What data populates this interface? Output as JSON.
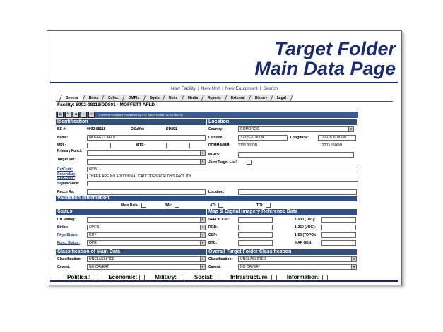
{
  "slide": {
    "title_line1": "Target Folder",
    "title_line2": "Main Data Page"
  },
  "nav": {
    "items": [
      "New Facility",
      "New Unit",
      "New Equipment",
      "Search"
    ],
    "separator": "|"
  },
  "tabs": [
    "General",
    "Bmks",
    "Collec",
    "DMPIs",
    "Equip",
    "Units",
    "Media",
    "Reports",
    "External",
    "History",
    "Legal"
  ],
  "facility": "Facility: 8992-08118/DD801 - MOFFETT AFLD",
  "toolbar": {
    "message": "Folder is Published (Published by FTC Saum MoffAF on 04 Nov 02 )"
  },
  "identification": {
    "header": "Identification",
    "be_label": "BE #:",
    "be_value": "0992-08118",
    "osuffix_label": "OSuffix:",
    "osuffix_value": "DD801",
    "name_label": "Name:",
    "name_value": "MOFFETT AFLD",
    "mrl_label": "MRL:",
    "mtf_label": "MTF:",
    "primary_label": "Primary Funct:",
    "target_set_label": "Target Set:",
    "catcode_label": "CatCode:",
    "catcode_value": "80051 -",
    "secondary_label": "Secondary CatCodes:",
    "secondary_value": "THERE ARE NO ADDITIONAL CATCODES FOR THIS FACILITY",
    "significance_label": "Significance:",
    "recce_label": "Recce Rx:"
  },
  "location": {
    "header": "Location",
    "country_label": "Country:",
    "country_value": "COMOROS",
    "latitude_label": "Latitude:",
    "latitude_value": "37-05-20.800N",
    "longitude_label": "Longitude:",
    "longitude_value": "122-03-39.000W",
    "ddmm_label": "DDMM.MMM:",
    "ddmm_lat": "3705.3333N",
    "ddmm_lon": "12203.6500W",
    "mgrs_label": "MGRS:",
    "joint_label": "Joint Target List?",
    "location_label": "Location:"
  },
  "validation": {
    "header": "Validation Information",
    "main_data_label": "Main Data:",
    "bai_label": "BAI:",
    "ati_label": "ATI:",
    "tdi_label": "TDI:"
  },
  "status": {
    "header": "Status",
    "cd_label": "CD Rating:",
    "strike_label": "Strike:",
    "strike_value": "OPEN",
    "phys_label": "Phys Status:",
    "phys_value": "RDY",
    "funct_label": "Funct Status:",
    "funct_value": "OPR"
  },
  "imagery": {
    "header": "Map & Digital Imagery Reference Data",
    "spob_label": "SPPOB Cell:",
    "rgb_label": "RGB:",
    "osp_label": "OSP:",
    "btg_label": "BTG:",
    "tpc_label": "1-500 (TPC):",
    "jog_label": "1-250 (JOG):",
    "topo_label": "1-50 (TOPO):",
    "mapgen_label": "MAP GEN:"
  },
  "classification_main": {
    "header": "Classification of Main Data",
    "class_label": "Classification:",
    "class_value": "UNCLASSIFIED",
    "caveat_label": "Caveat:",
    "caveat_value": "NO CAVEAT"
  },
  "classification_overall": {
    "header": "Overall Target Folder Classification",
    "class_label": "Classification:",
    "class_value": "UNCLASSIFIED",
    "caveat_label": "Caveat:",
    "caveat_value": "NO CAVEAT"
  },
  "categories": [
    "Political:",
    "Economic:",
    "Military:",
    "Social:",
    "Infrastructure:",
    "Information:"
  ]
}
